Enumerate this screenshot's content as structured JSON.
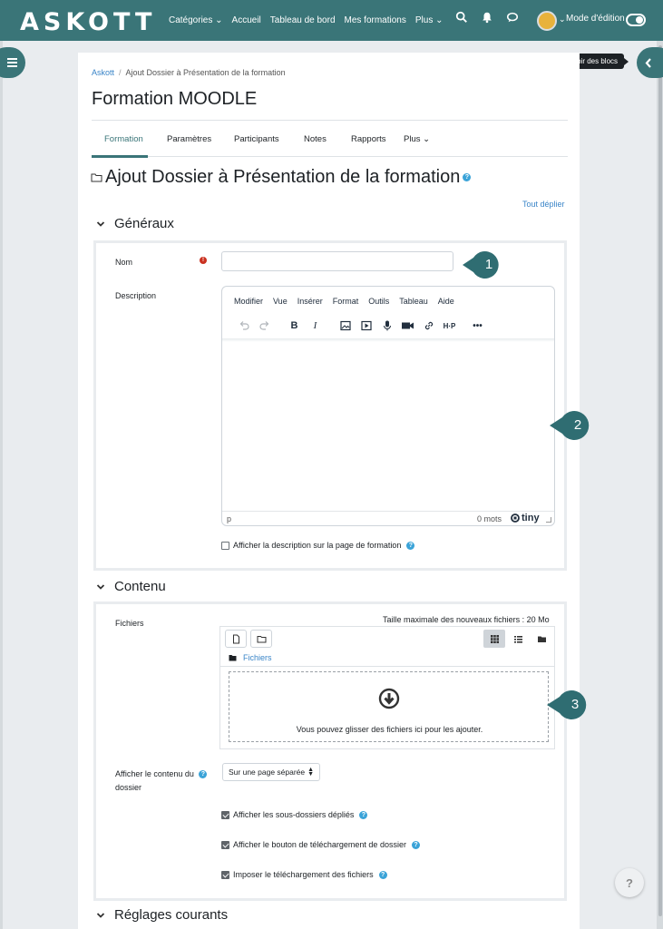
{
  "navbar": {
    "brand": "ASKOTT",
    "links": [
      "Catégories ⌄",
      "Accueil",
      "Tableau de bord",
      "Mes formations",
      "Plus ⌄"
    ],
    "edit_mode_label": "Mode d'édition",
    "icons": [
      "search-icon",
      "bell-icon",
      "chat-icon"
    ]
  },
  "drawer": {
    "tooltip": "Ouvrir le tiroir des blocs"
  },
  "breadcrumb": {
    "home": "Askott",
    "separator": "/",
    "current": "Ajout Dossier à Présentation de la formation"
  },
  "course": {
    "title": "Formation MOODLE"
  },
  "tabs": [
    {
      "label": "Formation",
      "active": true
    },
    {
      "label": "Paramètres",
      "active": false
    },
    {
      "label": "Participants",
      "active": false
    },
    {
      "label": "Notes",
      "active": false
    },
    {
      "label": "Rapports",
      "active": false
    },
    {
      "label": "Plus ⌄",
      "active": false
    }
  ],
  "form": {
    "heading": "Ajout Dossier à Présentation de la formation",
    "expand_all": "Tout déplier",
    "general": {
      "title": "Généraux",
      "name_label": "Nom",
      "name_value": "",
      "description_label": "Description",
      "show_description_label": "Afficher la description sur la page de formation",
      "show_description_checked": false
    },
    "editor": {
      "menu": [
        "Modifier",
        "Vue",
        "Insérer",
        "Format",
        "Outils",
        "Tableau",
        "Aide"
      ],
      "path": "p",
      "word_count": "0 mots",
      "brand": "tiny"
    },
    "content": {
      "title": "Contenu",
      "files_label": "Fichiers",
      "max_size": "Taille maximale des nouveaux fichiers : 20 Mo",
      "folder_path": "Fichiers",
      "drop_text": "Vous pouvez glisser des fichiers ici pour les ajouter.",
      "display_label_1": "Afficher le contenu du",
      "display_label_2": "dossier",
      "display_value": "Sur une page séparée",
      "option_subfolders": "Afficher les sous-dossiers dépliés",
      "option_download_button": "Afficher le bouton de téléchargement de dossier",
      "option_force_download": "Imposer le téléchargement des fichiers"
    },
    "common": {
      "title": "Réglages courants"
    }
  },
  "callouts": [
    "1",
    "2",
    "3"
  ],
  "help_fab": "?",
  "colors": {
    "brand": "#3a7578",
    "link": "#3a85c8",
    "help": "#3aa3d8",
    "required": "#ca3120"
  }
}
